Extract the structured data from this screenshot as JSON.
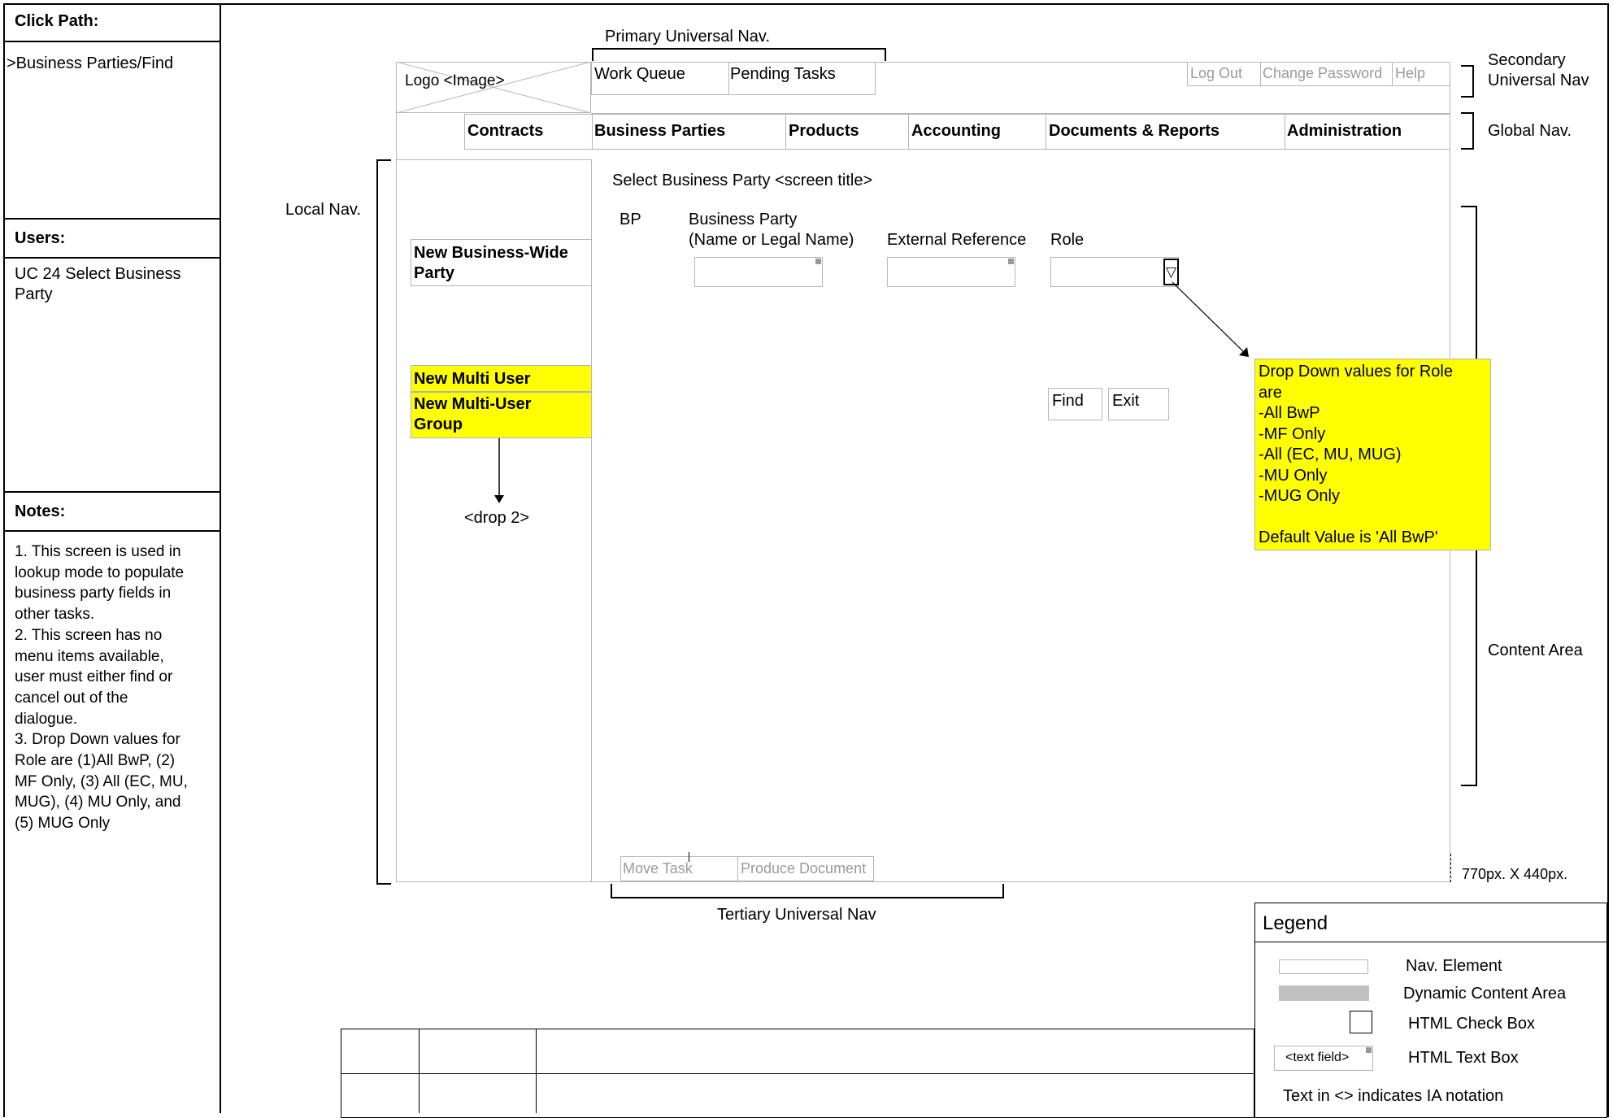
{
  "sidebar": {
    "click_path_heading": "Click Path:",
    "click_path_value": ">Business Parties/Find",
    "users_heading": "Users:",
    "users_value_1": "UC  24 Select Business",
    "users_value_2": "Party",
    "notes_heading": "Notes:",
    "notes_lines": [
      "1. This screen is used in",
      "lookup mode to populate",
      "business party fields in",
      "other tasks.",
      "2.  This screen has no",
      "menu items available,",
      "user must either find or",
      "cancel out of the",
      "dialogue.",
      "3. Drop Down values for",
      "Role are (1)All BwP, (2)",
      "MF Only, (3) All (EC, MU,",
      "MUG), (4) MU Only, and",
      "(5) MUG Only"
    ]
  },
  "annotations": {
    "primary_nav": "Primary Universal Nav.",
    "secondary_nav_1": "Secondary",
    "secondary_nav_2": "Universal Nav",
    "global_nav": "Global Nav.",
    "local_nav": "Local Nav.",
    "content_area": "Content Area",
    "tertiary_nav": "Tertiary Universal Nav",
    "dimensions": "770px. X 440px.",
    "drop2": "<drop 2>"
  },
  "logo": "Logo <Image>",
  "primary_nav": [
    "Work Queue",
    "Pending Tasks"
  ],
  "secondary_nav": [
    "Log Out",
    "Change Password",
    "Help"
  ],
  "global_nav": [
    "Contracts",
    "Business Parties",
    "Products",
    "Accounting",
    "Documents & Reports",
    "Administration"
  ],
  "local_nav": {
    "item1_line1": "New Business-Wide",
    "item1_line2": "Party",
    "item2": "New Multi User",
    "item3_line1": "New Multi-User",
    "item3_line2": "Group"
  },
  "content": {
    "screen_title": "Select Business Party <screen title>",
    "col_bp": "BP",
    "col_business_party_1": "Business Party",
    "col_business_party_2": "(Name or Legal Name)",
    "col_external_ref": "External Reference",
    "col_role": "Role",
    "dropdown_glyph": "▽",
    "find_button": "Find",
    "exit_button": "Exit"
  },
  "role_note": [
    "Drop Down values for Role",
    "are",
    "-All BwP",
    "-MF Only",
    "-All (EC, MU, MUG)",
    "-MU Only",
    "-MUG Only",
    "",
    "Default Value is 'All BwP'"
  ],
  "tertiary_nav": [
    "Move Task",
    "Produce Document"
  ],
  "legend": {
    "title": "Legend",
    "nav_element": "Nav. Element",
    "dynamic_content": "Dynamic Content Area",
    "check_box": "HTML Check Box",
    "text_field_sample": "<text field>",
    "text_box": "HTML Text Box",
    "notation": "Text in <> indicates IA notation"
  },
  "colors": {
    "highlight": "#ffff00",
    "nav_border": "#b5b5b5",
    "dynamic_area": "#c0c0c0",
    "muted_text": "#9a9a9a"
  }
}
